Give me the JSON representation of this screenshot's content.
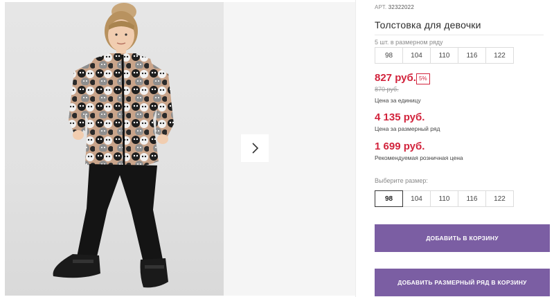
{
  "product": {
    "article_label": "АРТ.",
    "article_value": "32322022",
    "title": "Толстовка для девочки"
  },
  "pack": {
    "label": "5 шт. в размерном ряду",
    "sizes": [
      "98",
      "104",
      "110",
      "116",
      "122"
    ]
  },
  "pricing": {
    "unit_price": "827 руб.",
    "discount": "5%",
    "old_price": "870 руб.",
    "unit_caption": "Цена за единицу",
    "row_price": "4 135 руб.",
    "row_caption": "Цена за размерный ряд",
    "rrp_price": "1 699 руб.",
    "rrp_caption": "Рекомендуемая розничная цена"
  },
  "size_select": {
    "label": "Выберите размер:",
    "sizes": [
      "98",
      "104",
      "110",
      "116",
      "122"
    ],
    "selected": "98"
  },
  "buttons": {
    "add_to_cart": "ДОБАВИТЬ В КОРЗИНУ",
    "add_row_to_cart": "ДОБАВИТЬ РАЗМЕРНЫЙ РЯД В КОРЗИНУ"
  },
  "colors": {
    "accent": "#7b5ea3",
    "price": "#d2233c"
  }
}
